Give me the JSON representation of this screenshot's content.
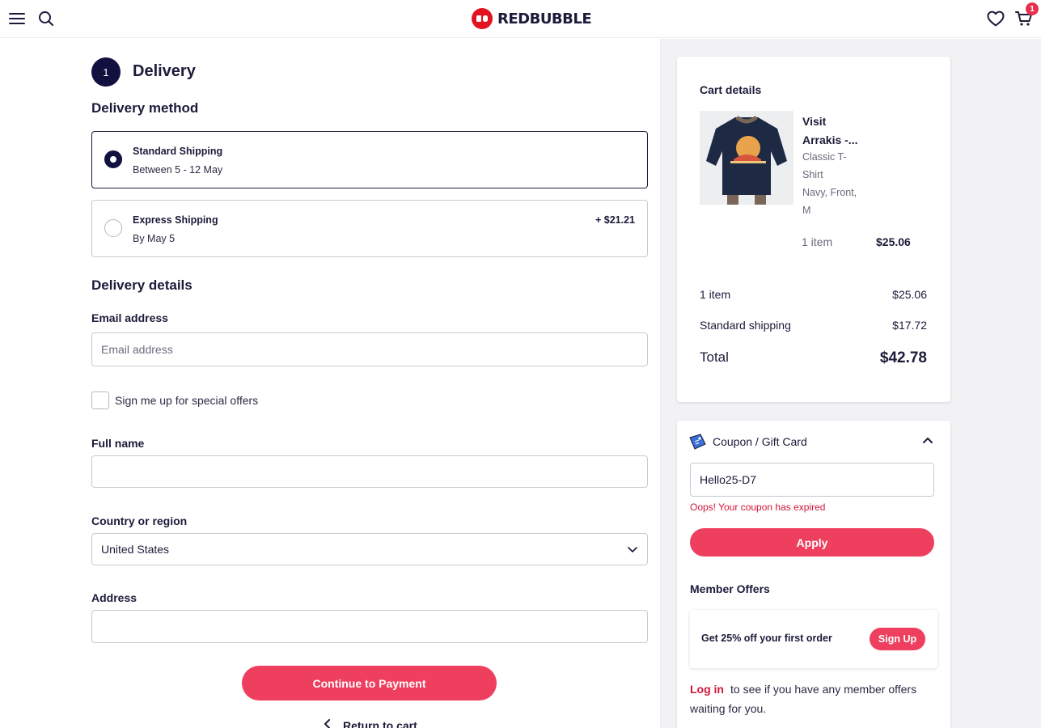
{
  "header": {
    "brand": "REDBUBBLE",
    "cart_count": "1"
  },
  "delivery": {
    "step_number": "1",
    "step_title": "Delivery",
    "method_title": "Delivery method",
    "options": [
      {
        "name": "Standard Shipping",
        "detail": "Between 5 - 12 May",
        "price": "",
        "selected": true
      },
      {
        "name": "Express Shipping",
        "detail": "By May 5",
        "price": "+ $21.21",
        "selected": false
      }
    ],
    "details_title": "Delivery details",
    "email_label": "Email address",
    "email_placeholder": "Email address",
    "offers_checkbox_label": "Sign me up for special offers",
    "fullname_label": "Full name",
    "country_label": "Country or region",
    "country_value": "United States",
    "address_label": "Address",
    "continue_label": "Continue to Payment",
    "return_label": "Return to cart"
  },
  "cart": {
    "title": "Cart details",
    "product_title": "Visit Arrakis -...",
    "product_desc_1": "Classic T-Shirt",
    "product_desc_2": "Navy, Front, M",
    "product_qty": "1 item",
    "product_price": "$25.06",
    "summary": {
      "items_label": "1 item",
      "items_value": "$25.06",
      "shipping_label": "Standard shipping",
      "shipping_value": "$17.72",
      "total_label": "Total",
      "total_value": "$42.78"
    }
  },
  "coupon": {
    "title": "Coupon / Gift Card",
    "value": "Hello25-D7",
    "error": "Oops! Your coupon has expired",
    "apply_label": "Apply"
  },
  "member": {
    "title": "Member Offers",
    "offer_text": "Get 25% off your first order",
    "signup_label": "Sign Up",
    "login_link": "Log in",
    "login_text": "to see if you have any member offers waiting for you."
  },
  "colors": {
    "accent": "#ee3f5e",
    "brand_red": "#e41321",
    "navy": "#11103e",
    "error": "#d0163a"
  },
  "icons": [
    "menu-icon",
    "search-icon",
    "redbubble-logo-icon",
    "heart-icon",
    "cart-icon",
    "chevron-down-icon",
    "chevron-up-icon",
    "chevron-left-icon",
    "coupon-tag-icon"
  ]
}
